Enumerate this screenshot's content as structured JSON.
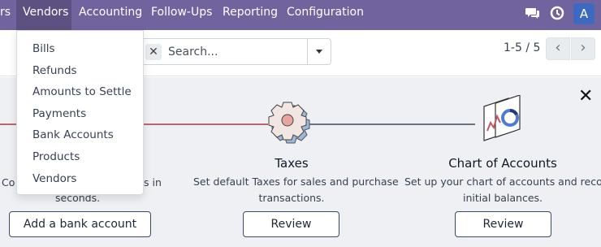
{
  "navbar": {
    "items": [
      {
        "label": "rs"
      },
      {
        "label": "Vendors"
      },
      {
        "label": "Accounting"
      },
      {
        "label": "Follow-Ups"
      },
      {
        "label": "Reporting"
      },
      {
        "label": "Configuration"
      }
    ],
    "avatar": "A",
    "icons": [
      "chat-icon",
      "clock-icon"
    ]
  },
  "vendors_menu": {
    "items": [
      {
        "label": "Bills"
      },
      {
        "label": "Refunds"
      },
      {
        "label": "Amounts to Settle"
      },
      {
        "label": "Payments"
      },
      {
        "label": "Bank Accounts"
      },
      {
        "label": "Products"
      },
      {
        "label": "Vendors"
      }
    ]
  },
  "search": {
    "placeholder": "Search...",
    "value": ""
  },
  "pager": {
    "value": "1-5 / 5",
    "prev": "‹",
    "next": "›"
  },
  "onboarding": {
    "close": "✕",
    "steps": [
      {
        "title": "",
        "desc_line1_left": "Co",
        "desc_line1_right": "s in",
        "desc_line2": "seconds.",
        "button": "Add a bank account"
      },
      {
        "title": "Taxes",
        "desc_line1": "Set default Taxes for sales and purchase",
        "desc_line2": "transactions.",
        "button": "Review"
      },
      {
        "title": "Chart of Accounts",
        "desc_line1": "Set up your chart of accounts and record",
        "desc_line2": "initial balances.",
        "button": "Review"
      }
    ]
  },
  "colors": {
    "navbar": "#71639e",
    "navbar_active": "#5d5182",
    "avatar": "#3d6ac0",
    "panel_bg": "#eef0f3",
    "progress_done": "#b8676e"
  }
}
